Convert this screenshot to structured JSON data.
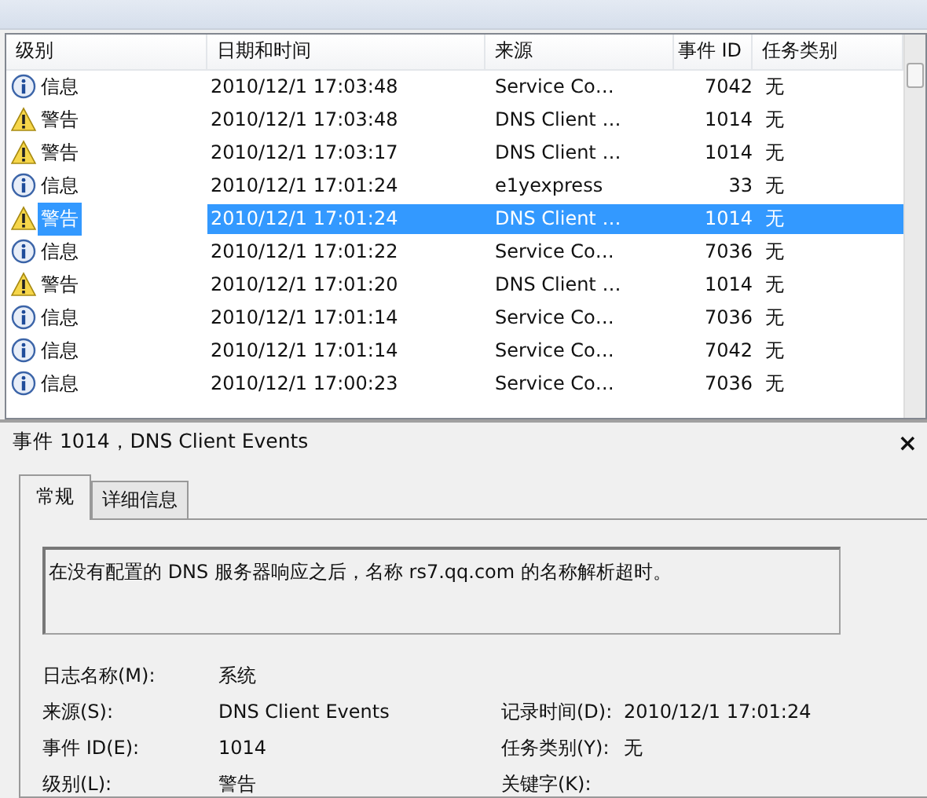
{
  "event_list": {
    "columns": [
      "级别",
      "日期和时间",
      "来源",
      "事件 ID",
      "任务类别"
    ],
    "rows": [
      {
        "kind": "info",
        "level": "信息",
        "datetime": "2010/12/1 17:03:48",
        "source": "Service Co…",
        "event_id": "7042",
        "task": "无",
        "selected": false
      },
      {
        "kind": "warning",
        "level": "警告",
        "datetime": "2010/12/1 17:03:48",
        "source": "DNS Client …",
        "event_id": "1014",
        "task": "无",
        "selected": false
      },
      {
        "kind": "warning",
        "level": "警告",
        "datetime": "2010/12/1 17:03:17",
        "source": "DNS Client …",
        "event_id": "1014",
        "task": "无",
        "selected": false
      },
      {
        "kind": "info",
        "level": "信息",
        "datetime": "2010/12/1 17:01:24",
        "source": "e1yexpress",
        "event_id": "33",
        "task": "无",
        "selected": false
      },
      {
        "kind": "warning",
        "level": "警告",
        "datetime": "2010/12/1 17:01:24",
        "source": "DNS Client …",
        "event_id": "1014",
        "task": "无",
        "selected": true
      },
      {
        "kind": "info",
        "level": "信息",
        "datetime": "2010/12/1 17:01:22",
        "source": "Service Co…",
        "event_id": "7036",
        "task": "无",
        "selected": false
      },
      {
        "kind": "warning",
        "level": "警告",
        "datetime": "2010/12/1 17:01:20",
        "source": "DNS Client …",
        "event_id": "1014",
        "task": "无",
        "selected": false
      },
      {
        "kind": "info",
        "level": "信息",
        "datetime": "2010/12/1 17:01:14",
        "source": "Service Co…",
        "event_id": "7036",
        "task": "无",
        "selected": false
      },
      {
        "kind": "info",
        "level": "信息",
        "datetime": "2010/12/1 17:01:14",
        "source": "Service Co…",
        "event_id": "7042",
        "task": "无",
        "selected": false
      },
      {
        "kind": "info",
        "level": "信息",
        "datetime": "2010/12/1 17:00:23",
        "source": "Service Co…",
        "event_id": "7036",
        "task": "无",
        "selected": false
      }
    ]
  },
  "detail": {
    "title": "事件 1014，DNS Client Events",
    "close": "×",
    "tabs": [
      {
        "label": "常规",
        "selected": true
      },
      {
        "label": "详细信息",
        "selected": false
      }
    ],
    "message": "在没有配置的 DNS 服务器响应之后，名称 rs7.qq.com 的名称解析超时。",
    "fields": [
      {
        "label": "日志名称(M):",
        "value": "系统"
      },
      {
        "label": "来源(S):",
        "value": "DNS Client Events",
        "label2": "记录时间(D):",
        "value2": "2010/12/1 17:01:24"
      },
      {
        "label": "事件 ID(E):",
        "value": "1014",
        "label2": "任务类别(Y):",
        "value2": "无"
      },
      {
        "label": "级别(L):",
        "value": "警告",
        "label2": "关键字(K):"
      }
    ]
  }
}
